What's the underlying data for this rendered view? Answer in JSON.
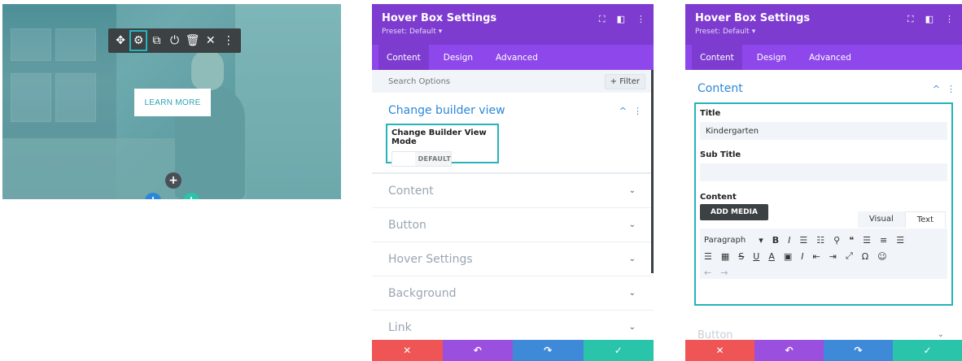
{
  "preview": {
    "learn_more_label": "LEARN MORE",
    "toolbar_icons": [
      "move-icon",
      "gear-icon",
      "duplicate-icon",
      "power-icon",
      "trash-icon",
      "close-icon",
      "more-icon"
    ],
    "add_label": "+"
  },
  "panel_mid": {
    "title": "Hover Box Settings",
    "preset": "Preset: Default ▾",
    "tabs": [
      "Content",
      "Design",
      "Advanced"
    ],
    "search_placeholder": "Search Options",
    "filter_label": "+ Filter",
    "cbv_title": "Change builder view",
    "cbv_field_label": "Change Builder View Mode",
    "cbv_toggle_value": "DEFAULT",
    "sections": [
      "Content",
      "Button",
      "Hover Settings",
      "Background",
      "Link"
    ]
  },
  "panel_right": {
    "title": "Hover Box Settings",
    "preset": "Preset: Default ▾",
    "tabs": [
      "Content",
      "Design",
      "Advanced"
    ],
    "content_title": "Content",
    "title_label": "Title",
    "title_value": "Kindergarten",
    "subtitle_label": "Sub Title",
    "subtitle_value": "",
    "content_label": "Content",
    "add_media_label": "ADD MEDIA",
    "editor_tabs": [
      "Visual",
      "Text"
    ],
    "paragraph_label": "Paragraph",
    "next_section": "Button"
  },
  "colors": {
    "header_purple": "#7d3bcf",
    "tabs_purple": "#8e47ea",
    "accent_blue": "#2b87da",
    "highlight_teal": "#27b3b9",
    "cancel_red": "#ef5555",
    "undo_purple": "#9b4fdf",
    "redo_blue": "#3e8ad9",
    "save_green": "#29c4a9"
  }
}
